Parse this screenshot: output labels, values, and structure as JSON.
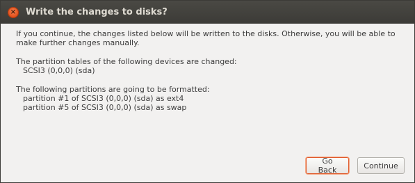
{
  "window": {
    "title": "Write the changes to disks?",
    "close_glyph": "×"
  },
  "body": {
    "intro": "If you continue, the changes listed below will be written to the disks. Otherwise, you will be able to make further changes manually.",
    "partition_tables_heading": "The partition tables of the following devices are changed:",
    "partition_tables_devices": [
      "SCSI3 (0,0,0) (sda)"
    ],
    "formatted_heading": "The following partitions are going to be formatted:",
    "formatted_partitions": [
      "partition #1 of SCSI3 (0,0,0) (sda) as ext4",
      "partition #5 of SCSI3 (0,0,0) (sda) as swap"
    ]
  },
  "buttons": {
    "go_back": "Go Back",
    "continue": "Continue"
  },
  "colors": {
    "accent": "#e05a2b",
    "titlebar": "#3c3b37",
    "dialog_bg": "#f2f1f0"
  },
  "icons": {
    "close": "close-icon"
  }
}
